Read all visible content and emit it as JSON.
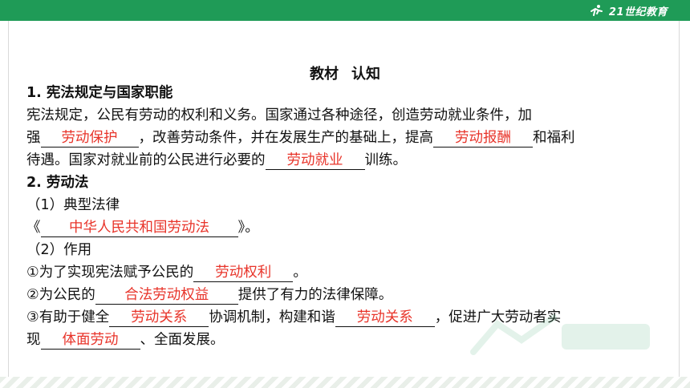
{
  "header": {
    "logo_text": "21世纪教育"
  },
  "title": {
    "left": "教材",
    "right": "认知"
  },
  "s1": {
    "heading": "1. 宪法规定与国家职能",
    "p1": "宪法规定，公民有劳动的权利和义务。国家通过各种途径，创造劳动就业条件，加",
    "p2a": "强",
    "b1": "劳动保护",
    "p2b": "，改善劳动条件，并在发展生产的基础上，提高",
    "b2": "劳动报酬",
    "p2c": "和福利",
    "p3a": "待遇。国家对就业前的公民进行必要的",
    "b3": "劳动就业",
    "p3b": "训练。"
  },
  "s2": {
    "heading": "2. 劳动法",
    "sub1": "（1）典型法律",
    "law_pre": "《",
    "b4": "中华人民共和国劳动法",
    "law_post": "》。",
    "sub2": "（2）作用",
    "r1a": "①为了实现宪法赋予公民的",
    "b5": "劳动权利",
    "r1b": "。",
    "r2a": "②为公民的",
    "b6": "合法劳动权益",
    "r2b": "提供了有力的法律保障。",
    "r3a": "③有助于健全",
    "b7": "劳动关系",
    "r3b": "协调机制，构建和谐",
    "b8": "劳动关系",
    "r3c": "，促进广大劳动者实",
    "r4a": "现",
    "b9": "体面劳动",
    "r4b": "、全面发展。"
  },
  "colors": {
    "accent": "#1f9b57",
    "answer": "#e8342a"
  }
}
